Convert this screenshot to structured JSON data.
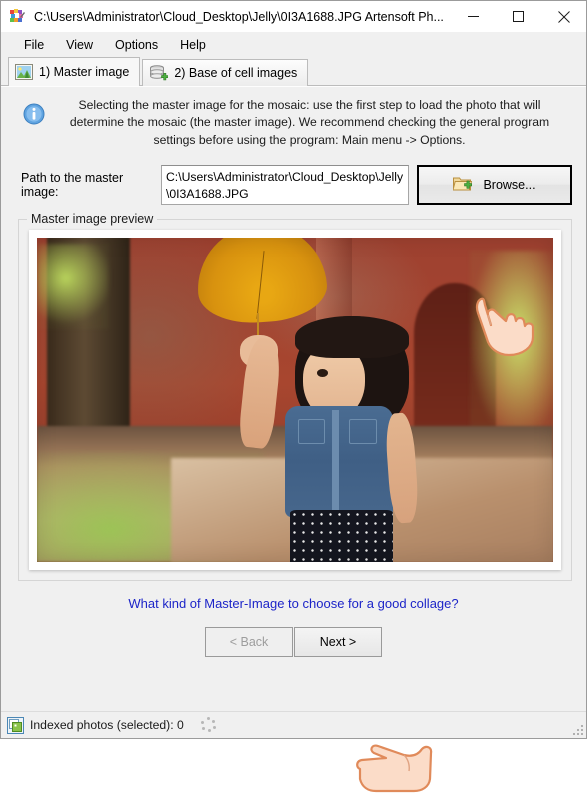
{
  "window": {
    "title": "C:\\Users\\Administrator\\Cloud_Desktop\\Jelly\\0I3A1688.JPG Artensoft Ph...",
    "app_icon": "mosaic-tiles-icon",
    "controls": {
      "minimize": "minimize-icon",
      "maximize": "maximize-icon",
      "close": "close-icon"
    }
  },
  "menu": {
    "items": [
      {
        "label": "File"
      },
      {
        "label": "View"
      },
      {
        "label": "Options"
      },
      {
        "label": "Help"
      }
    ]
  },
  "tabs": [
    {
      "label": "1) Master image",
      "icon": "picture-icon",
      "selected": true
    },
    {
      "label": "2) Base of cell images",
      "icon": "database-add-icon",
      "selected": false
    }
  ],
  "info": {
    "icon": "info-circle-icon",
    "text": "Selecting the master image for the mosaic: use the first step to load the photo that will determine the mosaic (the master image). We recommend checking the general program settings before using the program: Main menu -> Options."
  },
  "path_row": {
    "label": "Path to the master image:",
    "value": "C:\\Users\\Administrator\\Cloud_Desktop\\Jelly\\0I3A1688.JPG",
    "browse_label": "Browse...",
    "browse_icon": "folder-add-icon"
  },
  "preview": {
    "group_title": "Master image preview",
    "photo_alt": "Young child holding a large yellow leaf in front of a red temple wall"
  },
  "help_link": {
    "label": "What kind of Master-Image to choose for a good collage?",
    "color": "#1c24c8"
  },
  "wizard": {
    "back_label": "< Back",
    "back_disabled": true,
    "next_label": "Next >",
    "next_disabled": false
  },
  "status": {
    "icon": "indexed-photos-icon",
    "text": "Indexed photos (selected): 0",
    "spinner": "loading-dots-icon",
    "grip": "resize-grip-icon"
  },
  "cursors": [
    {
      "name": "hand-pointer-browse"
    },
    {
      "name": "hand-pointer-next"
    }
  ]
}
